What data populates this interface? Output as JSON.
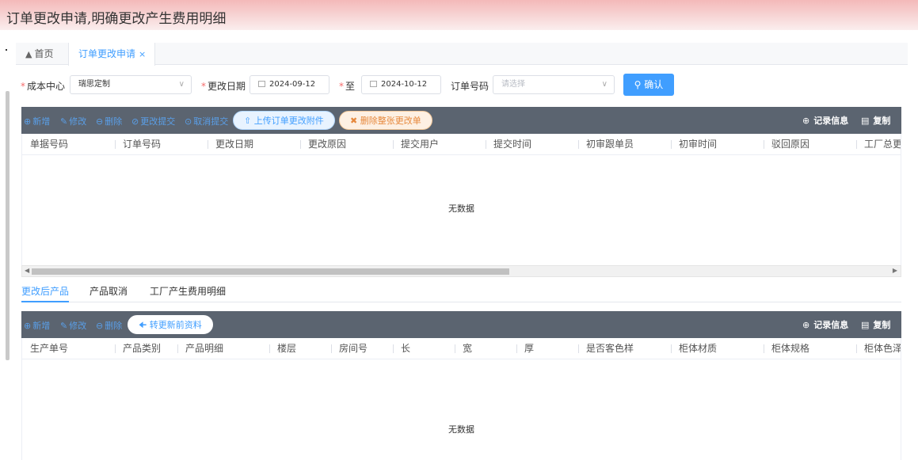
{
  "banner": {
    "title": "订单更改申请,明确更改产生费用明细"
  },
  "tabs": {
    "home": "首页",
    "active": "订单更改申请",
    "close": "×"
  },
  "filters": {
    "cost_center_label": "成本中心",
    "cost_center_value": "瑞思定制",
    "date_label": "更改日期",
    "date_from": "2024-09-12",
    "to_label": "至",
    "date_to": "2024-10-12",
    "order_no_label": "订单号码",
    "order_no_placeholder": "请选择",
    "confirm": "确认"
  },
  "toolbar1": {
    "add": "新增",
    "edit": "修改",
    "delete": "删除",
    "submit": "更改提交",
    "cancel_submit": "取消提交",
    "upload": "上传订单更改附件",
    "delete_all": "删除整张更改单",
    "record_info": "记录信息",
    "copy": "复制"
  },
  "grid1": {
    "columns": [
      "单据号码",
      "订单号码",
      "更改日期",
      "更改原因",
      "提交用户",
      "提交时间",
      "初审跟单员",
      "初审时间",
      "驳回原因",
      "工厂总更"
    ],
    "empty": "无数据"
  },
  "subtabs": [
    "更改后产品",
    "产品取消",
    "工厂产生费用明细"
  ],
  "toolbar2": {
    "add": "新增",
    "edit": "修改",
    "delete": "删除",
    "transfer": "转更新前资料",
    "record_info": "记录信息",
    "copy": "复制"
  },
  "grid2": {
    "columns": [
      "生产单号",
      "产品类别",
      "产品明细",
      "楼层",
      "房间号",
      "长",
      "宽",
      "厚",
      "是否客色样",
      "柜体材质",
      "柜体规格",
      "柜体色泽"
    ],
    "empty": "无数据"
  },
  "colors": {
    "accent": "#409eff",
    "toolbar": "#5b6470",
    "required": "#f56c6c",
    "warning": "#e6883c"
  }
}
